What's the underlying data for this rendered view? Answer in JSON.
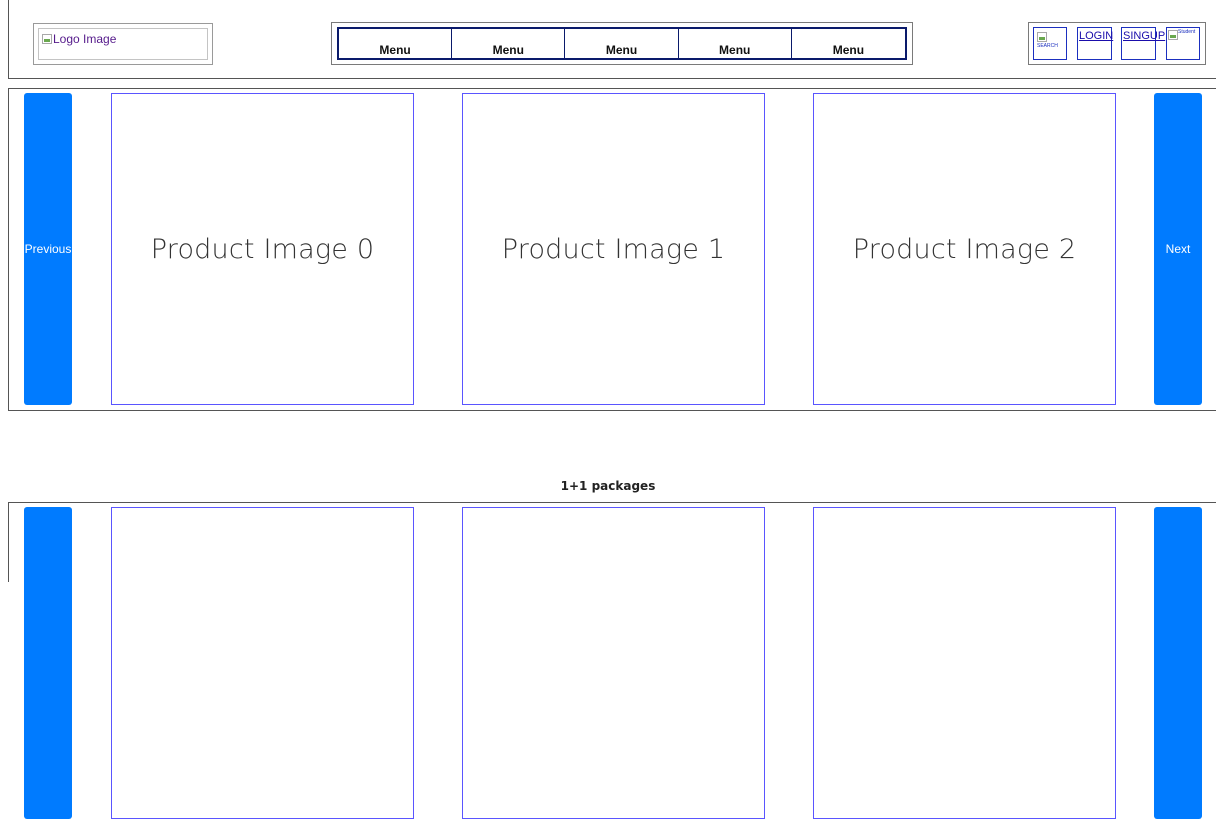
{
  "header": {
    "logo_alt": "Logo Image",
    "menu": [
      "Menu",
      "Menu",
      "Menu",
      "Menu",
      "Menu"
    ],
    "utility": {
      "search_caption": "SEARCH",
      "login_label": "LOGIN",
      "signup_label": "SINGUP",
      "student_caption": "Student"
    }
  },
  "carousel_1": {
    "prev_label": "Previous",
    "next_label": "Next",
    "products": [
      "Product Image 0",
      "Product Image 1",
      "Product Image 2"
    ]
  },
  "section_2": {
    "title": "1+1 packages"
  },
  "colors": {
    "button_blue": "#007bff",
    "product_border": "#5a55ff",
    "menu_border": "#0a1a6b"
  }
}
